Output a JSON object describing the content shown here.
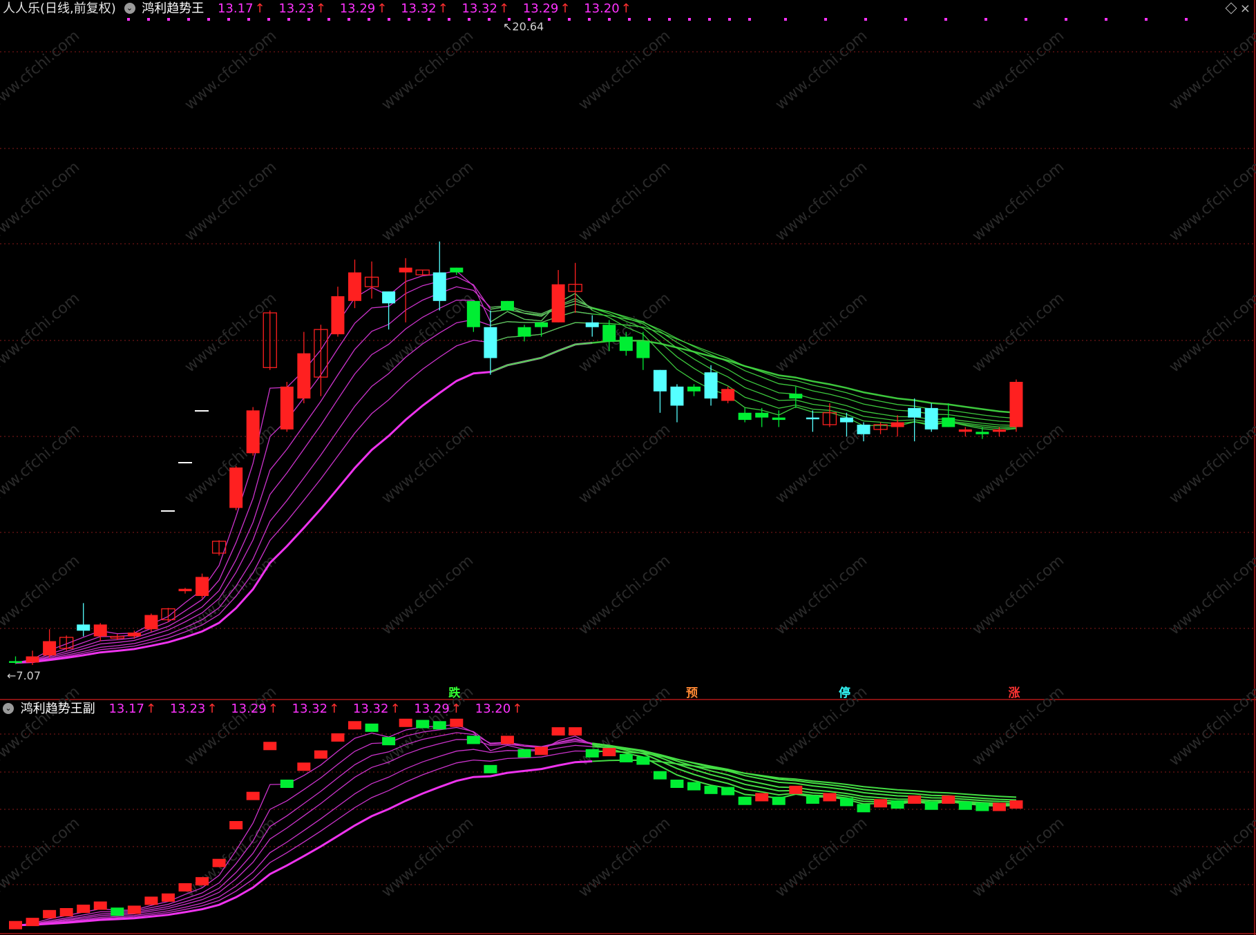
{
  "header_top": {
    "stock": "人人乐(日线,前复权)",
    "indicator": "鸿利趋势王",
    "values": [
      "13.17",
      "13.23",
      "13.29",
      "13.32",
      "13.32",
      "13.29",
      "13.20"
    ]
  },
  "header_bottom": {
    "indicator": "鸿利趋势王副",
    "values": [
      "13.17",
      "13.23",
      "13.29",
      "13.32",
      "13.32",
      "13.29",
      "13.20"
    ]
  },
  "colors": {
    "up": "#ff2020",
    "down": "#00ee33",
    "cyan": "#55ffff",
    "ma": "#cc33cc",
    "ma_thick": "#ee33ee",
    "green_ma": "#44dd44",
    "grid": "#8b1a1a"
  },
  "chart_data": {
    "type": "candlestick",
    "max_label": "20.64",
    "min_label": "7.07",
    "signals": [
      {
        "text": "跌",
        "color": "#33ff33",
        "bar": 26
      },
      {
        "text": "预",
        "color": "#ff8833",
        "bar": 40
      },
      {
        "text": "停",
        "color": "#33ffff",
        "bar": 49
      },
      {
        "text": "涨",
        "color": "#ff3333",
        "bar": 59
      }
    ],
    "candles": [
      [
        7.18,
        7.15,
        7.12,
        7.28,
        "g"
      ],
      [
        7.15,
        7.28,
        7.1,
        7.4,
        "r"
      ],
      [
        7.3,
        7.6,
        7.25,
        7.85,
        "r"
      ],
      [
        7.45,
        7.68,
        7.4,
        7.72,
        "r"
      ],
      [
        7.95,
        7.82,
        7.7,
        8.4,
        "c"
      ],
      [
        7.7,
        7.95,
        7.6,
        7.98,
        "r"
      ],
      [
        7.68,
        7.7,
        7.62,
        7.75,
        "r"
      ],
      [
        7.7,
        7.78,
        7.65,
        7.82,
        "r"
      ],
      [
        7.85,
        8.15,
        7.8,
        8.18,
        "r"
      ],
      [
        8.05,
        8.28,
        8.0,
        8.3,
        "r"
      ],
      [
        8.65,
        8.7,
        8.6,
        8.72,
        "r"
      ],
      [
        8.55,
        8.95,
        8.5,
        9.02,
        "r"
      ],
      [
        9.45,
        9.7,
        9.4,
        9.72,
        "r"
      ],
      [
        10.4,
        11.25,
        10.35,
        11.28,
        "r"
      ],
      [
        11.55,
        12.45,
        11.5,
        12.52,
        "r"
      ],
      [
        13.35,
        14.5,
        13.3,
        14.55,
        "r"
      ],
      [
        12.05,
        12.95,
        12.0,
        13.05,
        "r"
      ],
      [
        12.7,
        13.65,
        12.6,
        14.1,
        "r"
      ],
      [
        13.15,
        14.15,
        12.75,
        14.25,
        "r"
      ],
      [
        14.05,
        14.85,
        14.0,
        15.05,
        "r"
      ],
      [
        14.75,
        15.35,
        14.6,
        15.62,
        "r"
      ],
      [
        15.05,
        15.25,
        14.8,
        15.58,
        "r"
      ],
      [
        14.95,
        14.7,
        14.15,
        14.95,
        "c"
      ],
      [
        15.35,
        15.45,
        14.3,
        15.65,
        "r"
      ],
      [
        15.3,
        15.4,
        15.3,
        15.4,
        "r"
      ],
      [
        14.75,
        15.35,
        14.55,
        16.0,
        "c"
      ],
      [
        15.35,
        15.45,
        15.3,
        15.45,
        "g"
      ],
      [
        14.2,
        14.75,
        14.1,
        14.75,
        "g"
      ],
      [
        14.2,
        13.55,
        13.2,
        14.55,
        "c"
      ],
      [
        14.55,
        14.75,
        14.55,
        14.75,
        "g"
      ],
      [
        14.0,
        14.2,
        13.9,
        14.25,
        "g"
      ],
      [
        14.2,
        14.3,
        14.0,
        14.3,
        "g"
      ],
      [
        14.3,
        15.1,
        14.3,
        15.4,
        "r"
      ],
      [
        14.95,
        15.1,
        14.5,
        15.55,
        "r"
      ],
      [
        14.3,
        14.2,
        14.0,
        14.45,
        "c"
      ],
      [
        13.9,
        14.25,
        13.7,
        14.35,
        "g"
      ],
      [
        13.7,
        14.0,
        13.6,
        14.1,
        "g"
      ],
      [
        13.55,
        13.9,
        13.3,
        14.1,
        "g"
      ],
      [
        12.85,
        13.3,
        12.4,
        13.3,
        "c"
      ],
      [
        12.55,
        12.95,
        12.2,
        13.0,
        "c"
      ],
      [
        12.95,
        12.85,
        12.75,
        13.0,
        "g"
      ],
      [
        13.25,
        12.7,
        12.55,
        13.4,
        "c"
      ],
      [
        12.9,
        12.65,
        12.6,
        12.95,
        "r"
      ],
      [
        12.4,
        12.25,
        12.2,
        12.5,
        "g"
      ],
      [
        12.3,
        12.4,
        12.1,
        12.5,
        "g"
      ],
      [
        12.3,
        12.25,
        12.1,
        12.45,
        "g"
      ],
      [
        12.8,
        12.7,
        12.5,
        12.95,
        "g"
      ],
      [
        12.3,
        12.3,
        12.0,
        12.45,
        "c"
      ],
      [
        12.15,
        12.4,
        12.1,
        12.6,
        "r"
      ],
      [
        12.3,
        12.2,
        11.9,
        12.4,
        "c"
      ],
      [
        12.15,
        11.95,
        11.8,
        12.2,
        "c"
      ],
      [
        12.05,
        12.15,
        11.95,
        12.2,
        "r"
      ],
      [
        12.2,
        12.1,
        11.9,
        12.35,
        "r"
      ],
      [
        12.5,
        12.3,
        11.8,
        12.7,
        "c"
      ],
      [
        12.5,
        12.05,
        12.0,
        12.6,
        "c"
      ],
      [
        12.1,
        12.3,
        12.1,
        12.6,
        "g"
      ],
      [
        12.0,
        12.05,
        11.9,
        12.1,
        "r"
      ],
      [
        11.95,
        12.0,
        11.85,
        12.1,
        "g"
      ],
      [
        12.05,
        12.0,
        11.9,
        12.1,
        "r"
      ],
      [
        13.05,
        12.1,
        12.0,
        13.1,
        "r"
      ]
    ]
  }
}
